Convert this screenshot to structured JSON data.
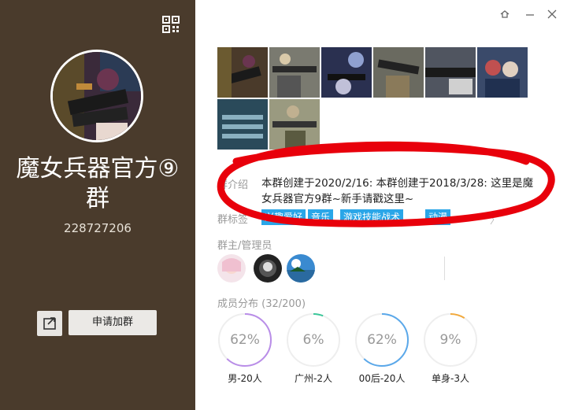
{
  "left_panel": {
    "group_name": "魔女兵器官方⑨群",
    "group_id": "228727206",
    "join_button": "申请加群",
    "qr_icon": "qr-code-icon",
    "share_icon": "share-icon"
  },
  "window": {
    "buttons": [
      "settings-icon",
      "minimize-icon",
      "close-icon"
    ]
  },
  "intro": {
    "label": "群介绍",
    "text": "本群创建于2020/2/16: 本群创建于2018/3/28: 这里是魔女兵器官方9群~新手请戳这里~"
  },
  "tags": {
    "label": "群标签",
    "items": [
      "兴趣爱好",
      "音乐",
      "游戏技能战术",
      "动漫"
    ]
  },
  "admins": {
    "label": "群主/管理员"
  },
  "members": {
    "label": "成员分布 (32/200)",
    "stats": [
      {
        "percent": "62%",
        "label": "男-20人",
        "ratio": 0.62,
        "color": "#b98de8"
      },
      {
        "percent": "6%",
        "label": "广州-2人",
        "ratio": 0.06,
        "color": "#3cc79a"
      },
      {
        "percent": "62%",
        "label": "00后-20人",
        "ratio": 0.62,
        "color": "#5aa8ea"
      },
      {
        "percent": "9%",
        "label": "单身-3人",
        "ratio": 0.09,
        "color": "#f2a93b"
      }
    ]
  },
  "colors": {
    "sidebar": "#4a3b2c",
    "tag": "#2aa6e8",
    "scribble": "#e8000b"
  }
}
